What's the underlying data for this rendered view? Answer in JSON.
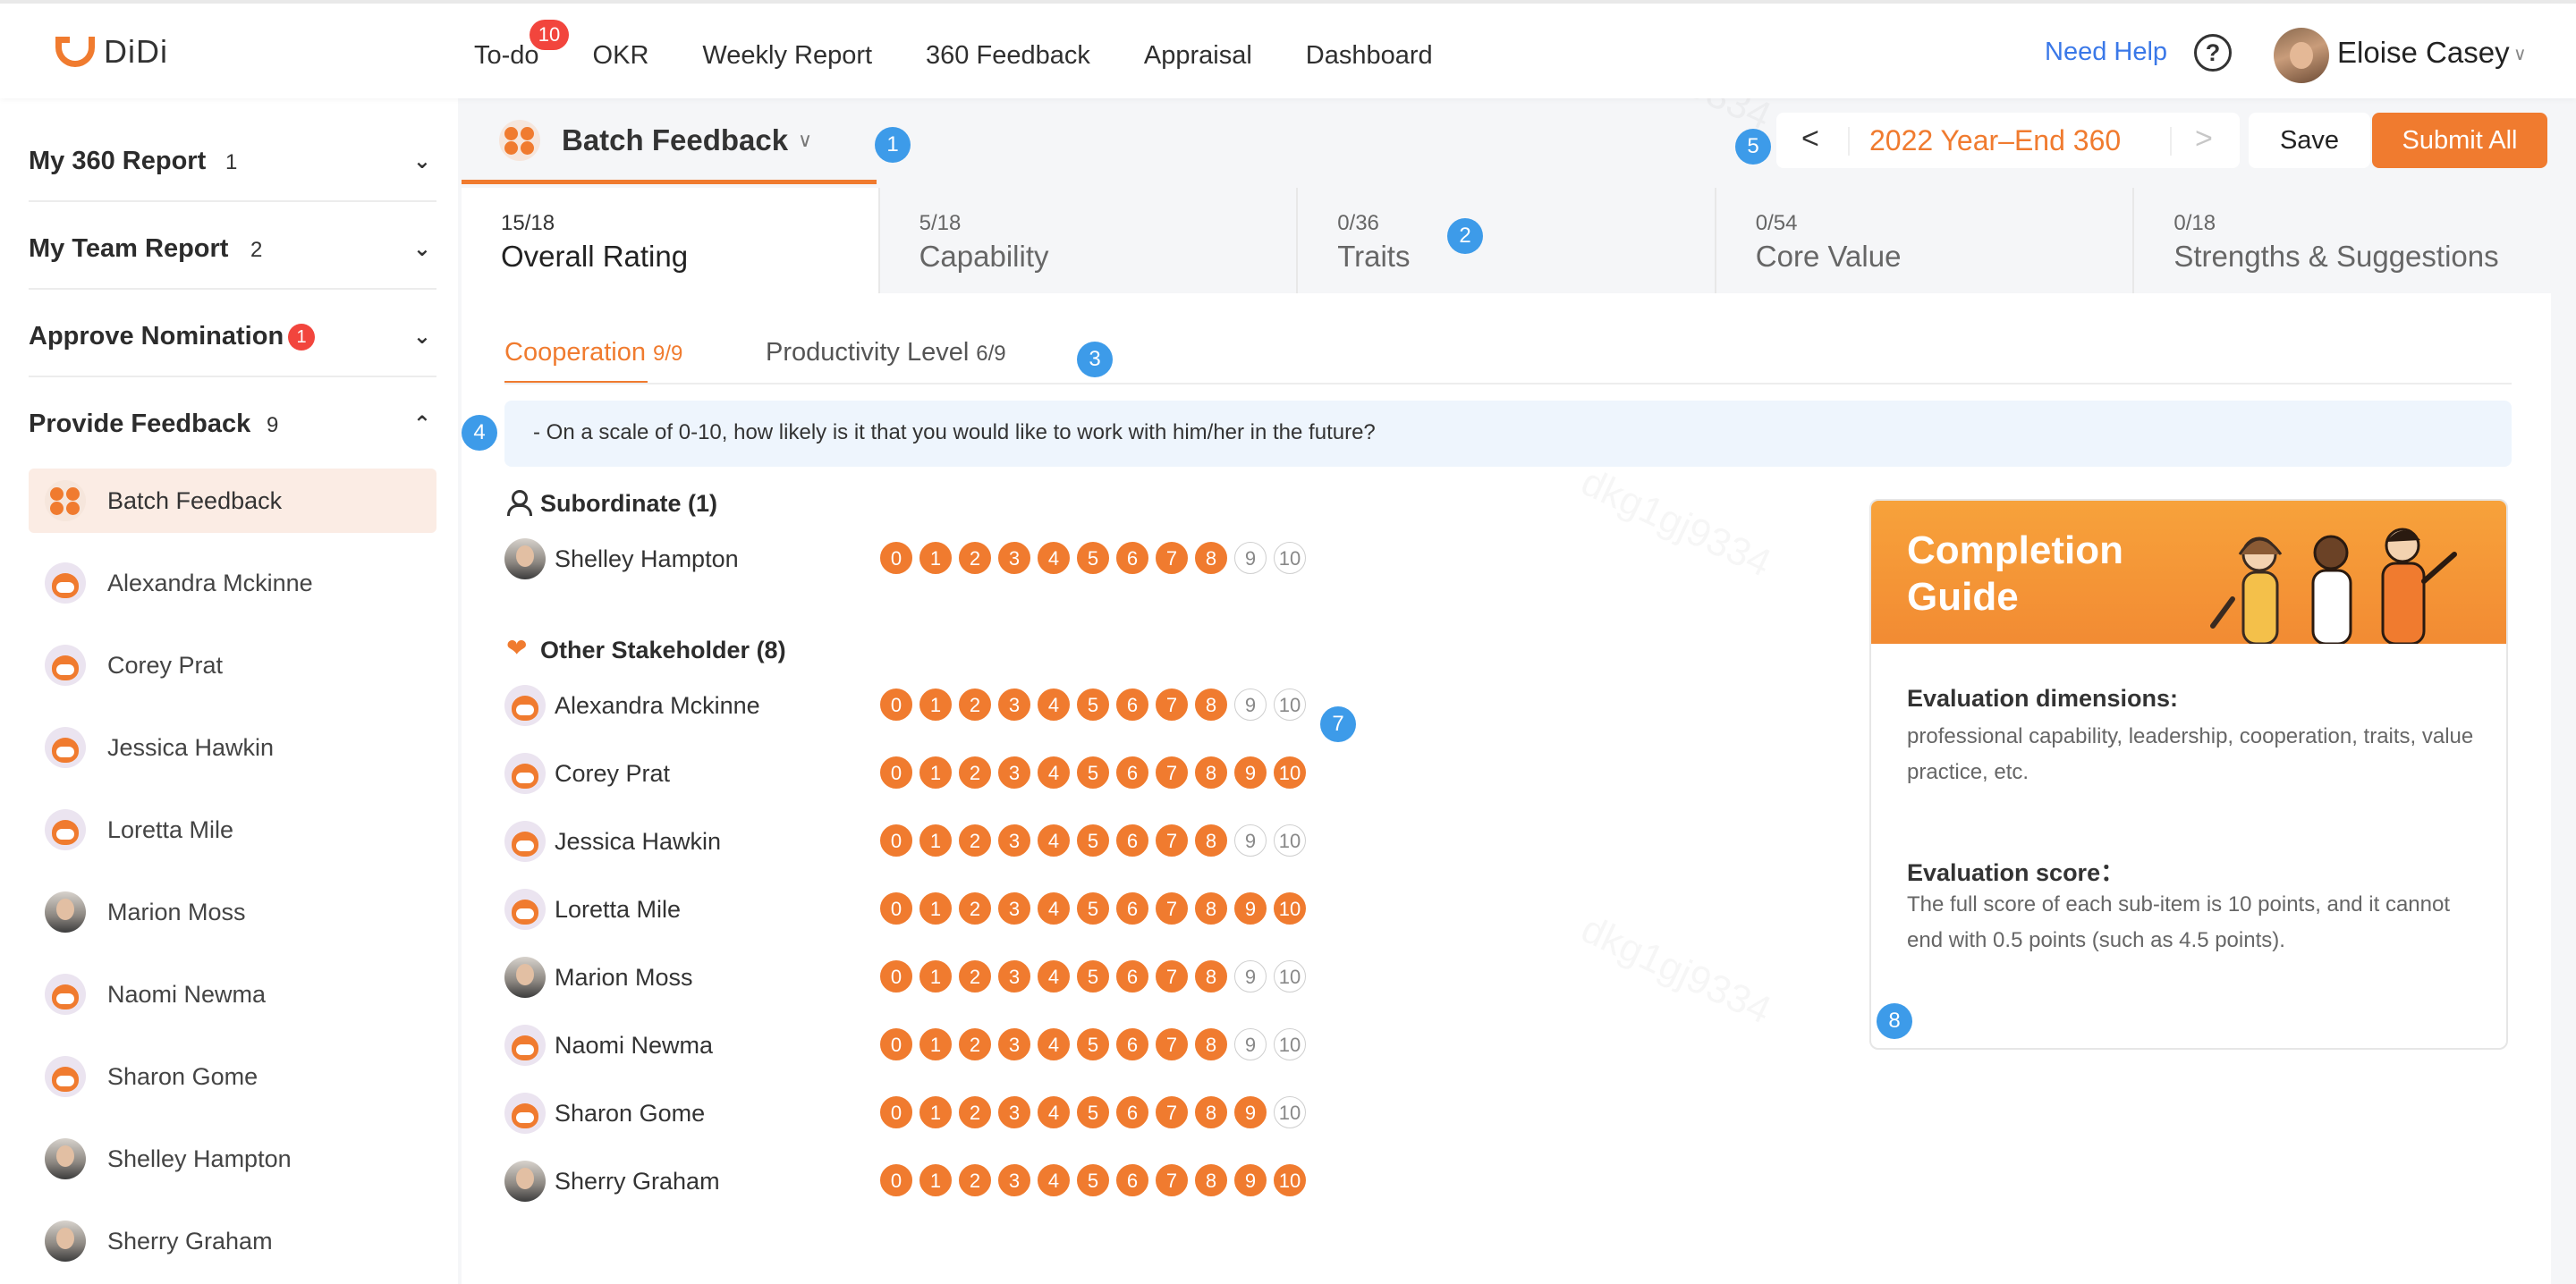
{
  "header": {
    "logo": "DiDi",
    "nav": [
      {
        "label": "To-do",
        "badge": "10"
      },
      {
        "label": "OKR"
      },
      {
        "label": "Weekly Report"
      },
      {
        "label": "360 Feedback"
      },
      {
        "label": "Appraisal"
      },
      {
        "label": "Dashboard"
      }
    ],
    "need_help": "Need Help",
    "help_icon": "?",
    "user_name": "Eloise Casey",
    "user_chevron": "∨"
  },
  "sidebar": {
    "sections": [
      {
        "title": "My 360 Report",
        "count": "1",
        "chevron": "⌄"
      },
      {
        "title": "My Team Report",
        "count": "2",
        "chevron": "⌄"
      },
      {
        "title": "Approve Nomination",
        "badge": "1",
        "chevron": "⌄"
      },
      {
        "title": "Provide Feedback",
        "count": "9",
        "chevron": "⌃"
      }
    ],
    "items": [
      {
        "name": "Batch Feedback"
      },
      {
        "name": "Alexandra Mckinne"
      },
      {
        "name": "Corey Prat"
      },
      {
        "name": "Jessica Hawkin"
      },
      {
        "name": "Loretta Mile"
      },
      {
        "name": "Marion Moss"
      },
      {
        "name": "Naomi Newma"
      },
      {
        "name": "Sharon Gome"
      },
      {
        "name": "Shelley Hampton"
      },
      {
        "name": "Sherry Graham"
      }
    ]
  },
  "main": {
    "batch_title": "Batch Feedback",
    "batch_chevron": "∨",
    "period": {
      "prev": "<",
      "label": "2022 Year–End 360",
      "next": ">"
    },
    "save_label": "Save",
    "submit_label": "Submit All",
    "markers": [
      "1",
      "2",
      "3",
      "4",
      "5",
      "7",
      "8"
    ],
    "tabs": [
      {
        "progress": "15/18",
        "label": "Overall Rating"
      },
      {
        "progress": "5/18",
        "label": "Capability"
      },
      {
        "progress": "0/36",
        "label": "Traits"
      },
      {
        "progress": "0/54",
        "label": "Core Value"
      },
      {
        "progress": "0/18",
        "label": "Strengths & Suggestions"
      }
    ],
    "sub_tabs": [
      {
        "label": "Cooperation",
        "count": "9/9"
      },
      {
        "label": "Productivity Level",
        "count": "6/9"
      }
    ],
    "question": "- On a scale of 0-10, how likely is it that you would like to work with him/her in the future?",
    "subordinate_title": "Subordinate  (1)",
    "stakeholder_title": "Other Stakeholder  (8)",
    "score_labels": [
      "0",
      "1",
      "2",
      "3",
      "4",
      "5",
      "6",
      "7",
      "8",
      "9",
      "10"
    ],
    "subordinates": [
      {
        "name": "Shelley Hampton",
        "score": 8
      }
    ],
    "stakeholders": [
      {
        "name": "Alexandra Mckinne",
        "score": 8
      },
      {
        "name": "Corey Prat",
        "score": 10
      },
      {
        "name": "Jessica Hawkin",
        "score": 8
      },
      {
        "name": "Loretta Mile",
        "score": 10
      },
      {
        "name": "Marion Moss",
        "score": 8
      },
      {
        "name": "Naomi Newma",
        "score": 8
      },
      {
        "name": "Sharon Gome",
        "score": 9
      },
      {
        "name": "Sherry Graham",
        "score": 10
      }
    ]
  },
  "guide": {
    "title": "Completion Guide",
    "dimensions_title": "Evaluation dimensions:",
    "dimensions_text": "professional capability, leadership, cooperation, traits, value practice, etc.",
    "score_title": "Evaluation score：",
    "score_text": "The full score of each sub-item is 10 points, and it cannot end with 0.5 points (such as 4.5 points)."
  },
  "colors": {
    "accent": "#f07b2f",
    "link": "#3a78e8",
    "marker": "#3d9be9",
    "badge": "#f2453d"
  }
}
